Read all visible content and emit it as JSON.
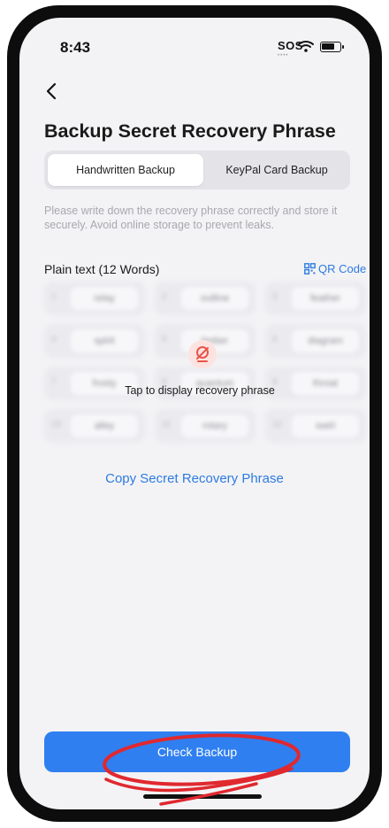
{
  "status_bar": {
    "time": "8:43",
    "carrier": "SOS",
    "carrier_dots": "••••"
  },
  "header": {
    "back_label": "<",
    "title": "Backup Secret Recovery Phrase"
  },
  "tabs": [
    {
      "label": "Handwritten Backup",
      "active": true
    },
    {
      "label": "KeyPal Card Backup",
      "active": false
    }
  ],
  "instructions": "Please write down the recovery phrase correctly and store it securely. Avoid online storage to prevent leaks.",
  "phrase_section": {
    "label": "Plain text (12 Words)",
    "qr_label": "QR Code",
    "reveal_text": "Tap to display recovery phrase",
    "words": [
      {
        "num": "1",
        "word": "relay"
      },
      {
        "num": "2",
        "word": "outline"
      },
      {
        "num": "3",
        "word": "feather"
      },
      {
        "num": "4",
        "word": "spirit"
      },
      {
        "num": "5",
        "word": "timber"
      },
      {
        "num": "6",
        "word": "diagram"
      },
      {
        "num": "7",
        "word": "frosty"
      },
      {
        "num": "8",
        "word": "quantum"
      },
      {
        "num": "9",
        "word": "throat"
      },
      {
        "num": "10",
        "word": "alley"
      },
      {
        "num": "11",
        "word": "rotary"
      },
      {
        "num": "12",
        "word": "swirl"
      }
    ]
  },
  "copy_link": "Copy Secret Recovery Phrase",
  "primary_button": "Check Backup",
  "colors": {
    "accent": "#2f7ff0",
    "link": "#2d7be0",
    "annotation": "#e0282f",
    "reveal_icon": "#e8554b"
  }
}
